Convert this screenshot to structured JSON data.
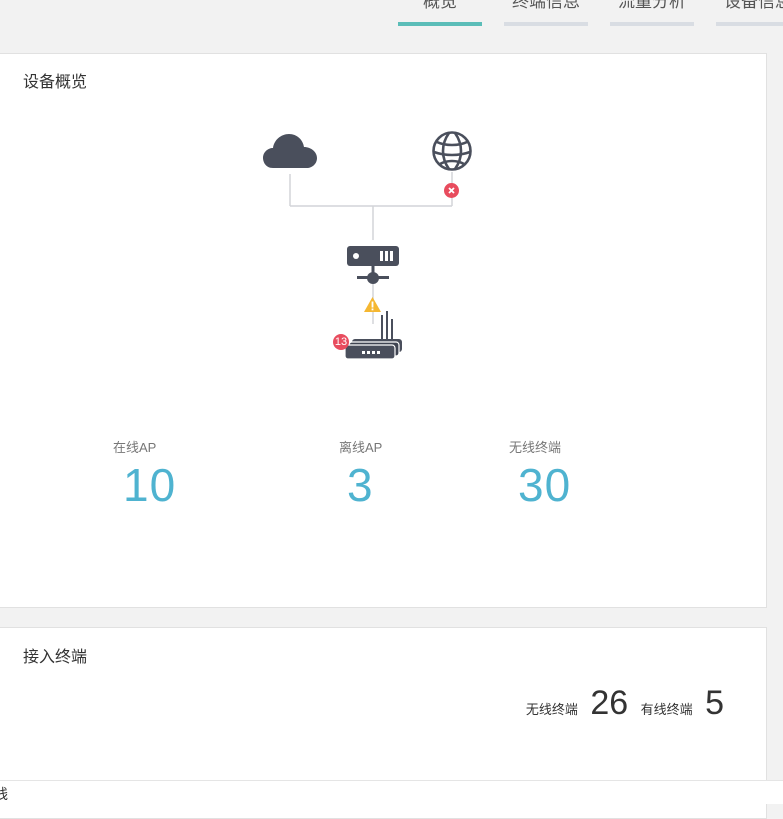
{
  "tabs": [
    {
      "label": "概览",
      "active": true
    },
    {
      "label": "终端信息",
      "active": false
    },
    {
      "label": "流量分析",
      "active": false
    },
    {
      "label": "设备信息",
      "active": false
    }
  ],
  "overview": {
    "title": "设备概览",
    "badge_count": "13",
    "stats": [
      {
        "label": "在线AP",
        "value": "10"
      },
      {
        "label": "离线AP",
        "value": "3"
      },
      {
        "label": "无线终端",
        "value": "30"
      }
    ]
  },
  "clients": {
    "title": "接入终端",
    "wireless_label": "无线终端",
    "wireless_count": "26",
    "wired_label": "有线终端",
    "wired_count": "5"
  },
  "bottom": {
    "text": "线"
  },
  "colors": {
    "accent": "#5bbdb8",
    "value": "#4fb3d0",
    "icon": "#4a4f5c",
    "error": "#e84c5e",
    "warning": "#f5b731"
  }
}
